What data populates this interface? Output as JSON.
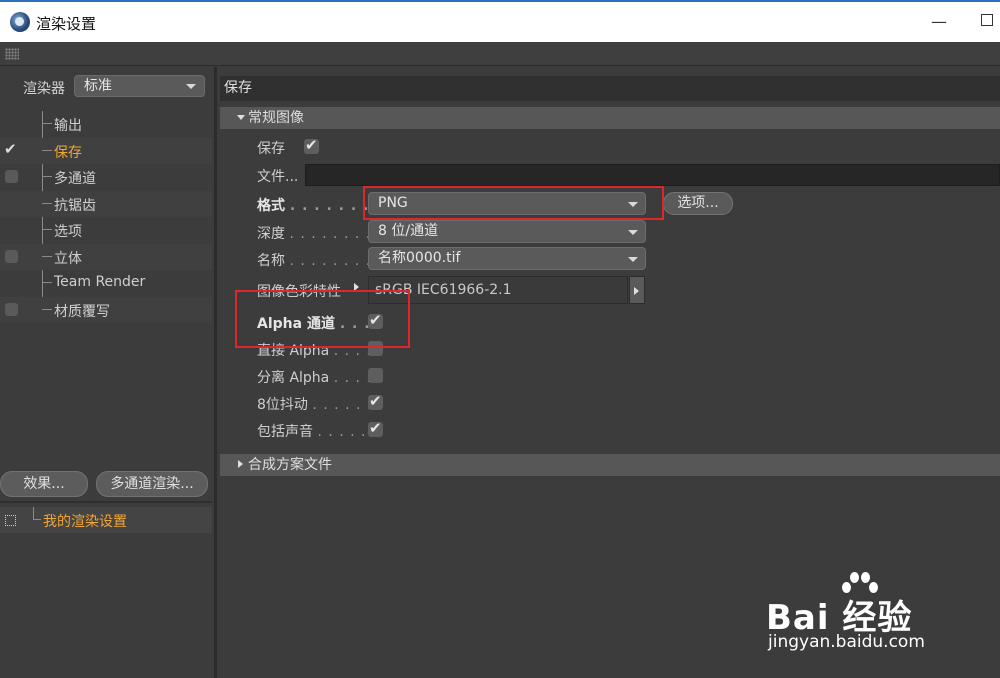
{
  "window": {
    "title": "渲染设置",
    "minimize": "—"
  },
  "left": {
    "renderer_label": "渲染器",
    "renderer_value": "标准",
    "tree": [
      {
        "label": "输出",
        "checkbox": "none",
        "active": false
      },
      {
        "label": "保存",
        "checkbox": "checked",
        "active": true
      },
      {
        "label": "多通道",
        "checkbox": "empty",
        "active": false
      },
      {
        "label": "抗锯齿",
        "checkbox": "none",
        "active": false
      },
      {
        "label": "选项",
        "checkbox": "none",
        "active": false
      },
      {
        "label": "立体",
        "checkbox": "empty",
        "active": false
      },
      {
        "label": "Team Render",
        "checkbox": "none",
        "active": false
      },
      {
        "label": "材质覆写",
        "checkbox": "empty",
        "active": false
      }
    ],
    "effects_button": "效果...",
    "multipass_button": "多通道渲染...",
    "preset_label": "我的渲染设置",
    "check_glyph": "✔"
  },
  "right": {
    "section_title": "保存",
    "group_regular": "常规图像",
    "save_label": "保存",
    "file_label": "文件...",
    "format_label": "格式",
    "format_value": "PNG",
    "options_button": "选项...",
    "depth_label": "深度",
    "depth_value": "8 位/通道",
    "name_label": "名称",
    "name_value": "名称0000.tif",
    "profile_label": "图像色彩特性",
    "profile_value": "sRGB IEC61966-2.1",
    "alpha_label": "Alpha 通道",
    "straight_alpha_label": "直接 Alpha",
    "separate_alpha_label": "分离 Alpha",
    "dither_label": "8位抖动",
    "sound_label": "包括声音",
    "dots_short": ". . . . . . . . .",
    "dots_alpha": ". . . .",
    "dots_dither": ". . . . . . .",
    "dots_sound": ". . . . . .",
    "group_composite": "合成方案文件",
    "checks": {
      "save": true,
      "alpha": true,
      "straight_alpha": false,
      "separate_alpha": false,
      "dither": true,
      "sound": true
    }
  },
  "watermark": {
    "brand": "Bai  经验",
    "url": "jingyan.baidu.com"
  },
  "colors": {
    "highlight": "#e0262c",
    "active_text": "#f0a637",
    "panel_bg": "#3c3c3c"
  }
}
